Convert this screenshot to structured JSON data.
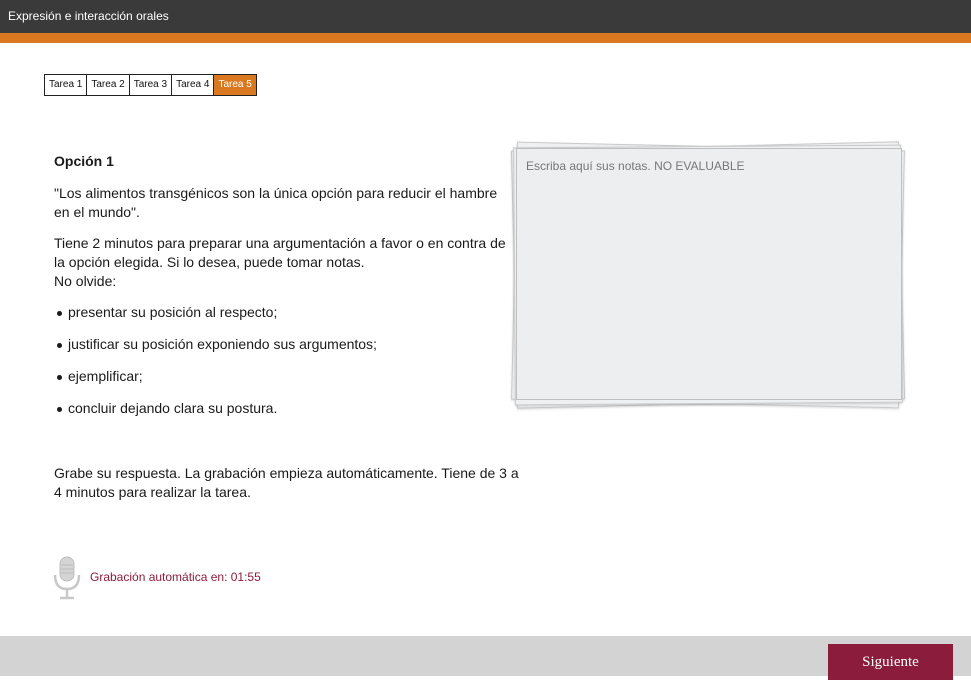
{
  "header": {
    "title": "Expresión e interacción orales"
  },
  "colors": {
    "accent": "#d9781f",
    "brand": "#8c1c3c",
    "topbar": "#3a3a3a",
    "footer": "#d3d3d3"
  },
  "tabs": [
    {
      "label": "Tarea 1",
      "active": false
    },
    {
      "label": "Tarea 2",
      "active": false
    },
    {
      "label": "Tarea 3",
      "active": false
    },
    {
      "label": "Tarea 4",
      "active": false
    },
    {
      "label": "Tarea 5",
      "active": true
    }
  ],
  "task": {
    "option_title": "Opción 1",
    "quote": "\"Los alimentos transgénicos son la única opción para reducir el hambre en el mundo\".",
    "instructions_line1": "Tiene 2 minutos para preparar una argumentación a favor o en contra de la opción elegida. Si lo desea, puede tomar notas.",
    "instructions_line2": "No olvide:",
    "bullets": [
      "presentar su posición al respecto;",
      "justificar su posición exponiendo sus argumentos;",
      "ejemplificar;",
      "concluir dejando clara su postura."
    ],
    "recording_instructions": "Grabe su respuesta. La grabación empieza automáticamente. Tiene de 3 a 4 minutos para realizar la tarea."
  },
  "recording": {
    "icon": "microphone-icon",
    "label": "Grabación automática en: 01:55"
  },
  "notes": {
    "placeholder": "Escriba aquí sus notas. NO EVALUABLE",
    "value": ""
  },
  "footer": {
    "next_label": "Siguiente"
  }
}
